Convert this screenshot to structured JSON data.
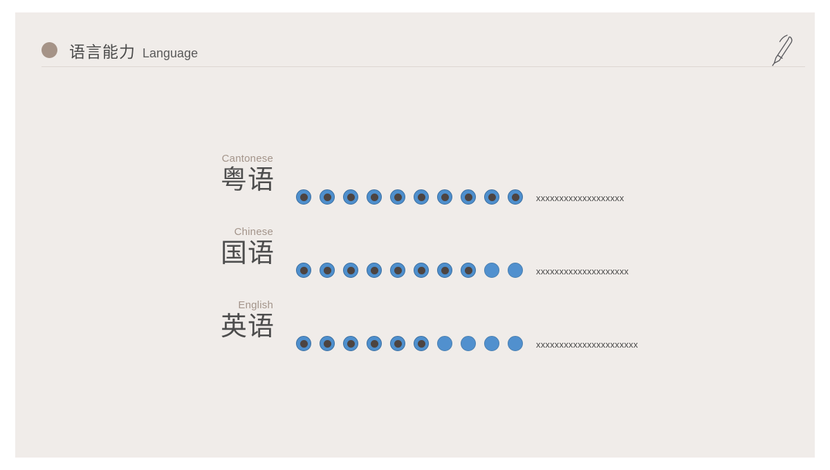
{
  "header": {
    "title_cn": "语言能力",
    "title_en": "Language",
    "bullet_color": "#a59387",
    "rule_color": "#ddd7d2",
    "pen_icon": "pen-icon"
  },
  "theme": {
    "background": "#ffffff",
    "card": "#f0ece9",
    "dot_fill_ring": "#4e8fcd",
    "dot_fill_center": "#4d4441",
    "dot_empty": "#5190ce",
    "label_en_color": "#a3948a",
    "label_cn_color": "#4d4d4d"
  },
  "rows": [
    {
      "label_en": "Cantonese",
      "label_cn": "粤语",
      "total_dots": 10,
      "filled_dots": 10,
      "note": "xxxxxxxxxxxxxxxxxxx"
    },
    {
      "label_en": "Chinese",
      "label_cn": "国语",
      "total_dots": 10,
      "filled_dots": 8,
      "note": "xxxxxxxxxxxxxxxxxxxx"
    },
    {
      "label_en": "English",
      "label_cn": "英语",
      "total_dots": 10,
      "filled_dots": 6,
      "note": "xxxxxxxxxxxxxxxxxxxxxx"
    }
  ]
}
